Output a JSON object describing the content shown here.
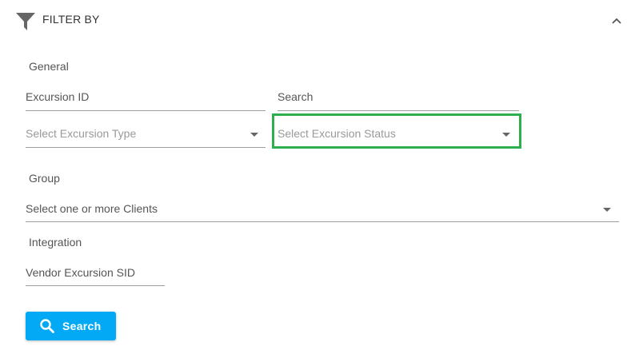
{
  "header": {
    "title": "FILTER BY",
    "filter_icon": "funnel-icon",
    "collapse_icon": "chevron-up-icon"
  },
  "sections": {
    "general": "General",
    "group": "Group",
    "integration": "Integration"
  },
  "fields": {
    "excursion_id": {
      "placeholder": "Excursion ID",
      "value": ""
    },
    "search": {
      "placeholder": "Search",
      "value": ""
    },
    "excursion_type": {
      "placeholder": "Select Excursion Type",
      "selected": ""
    },
    "excursion_status": {
      "placeholder": "Select Excursion Status",
      "selected": ""
    },
    "clients": {
      "placeholder": "Select one or more Clients",
      "selected": ""
    },
    "vendor_sid": {
      "placeholder": "Vendor Excursion SID",
      "value": ""
    }
  },
  "search_button": {
    "label": "Search",
    "icon": "search-icon"
  },
  "colors": {
    "accent": "#03a9f4",
    "highlight": "#2fae4e"
  }
}
